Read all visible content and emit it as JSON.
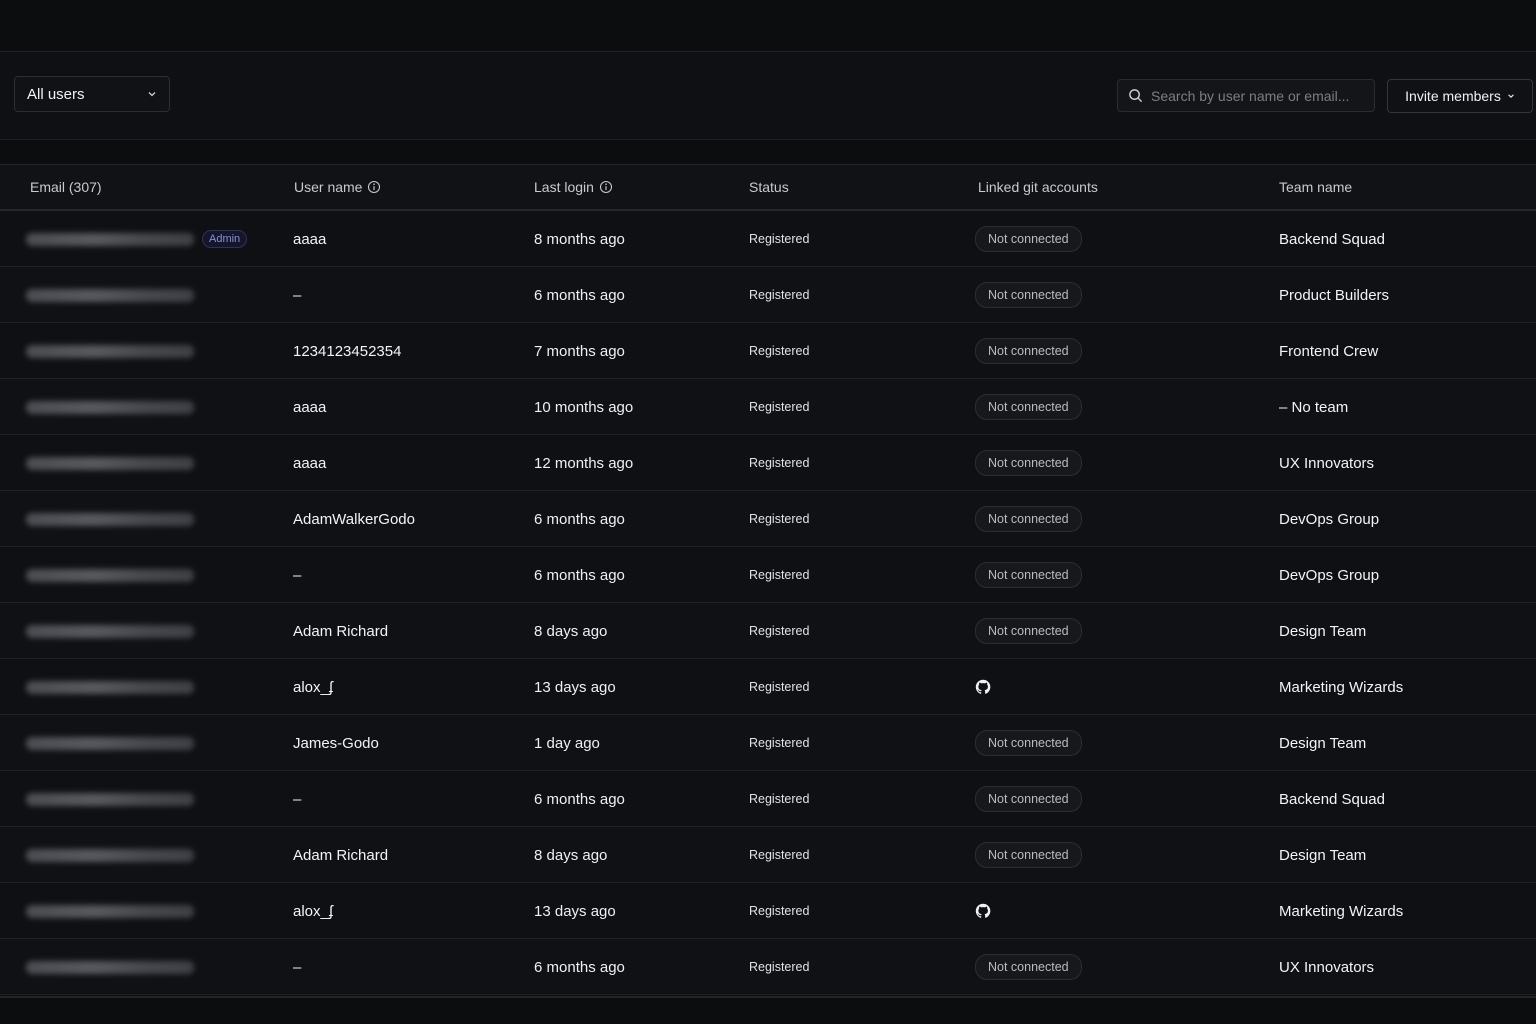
{
  "toolbar": {
    "filter_label": "All users",
    "search_placeholder": "Search by user name or email...",
    "invite_label": "Invite members"
  },
  "table": {
    "headers": {
      "email": "Email (307)",
      "user_name": "User name",
      "last_login": "Last login",
      "status": "Status",
      "linked_git": "Linked git accounts",
      "team_name": "Team name"
    },
    "rows": [
      {
        "admin": "Admin",
        "user": "aaaa",
        "login": "8 months ago",
        "status": "Registered",
        "git": "Not connected",
        "team": "Backend Squad"
      },
      {
        "user": "–",
        "login": "6 months ago",
        "status": "Registered",
        "git": "Not connected",
        "team": "Product Builders"
      },
      {
        "user": "1234123452354",
        "login": "7 months ago",
        "status": "Registered",
        "git": "Not connected",
        "team": "Frontend Crew"
      },
      {
        "user": "aaaa",
        "login": "10 months ago",
        "status": "Registered",
        "git": "Not connected",
        "team": "– No team"
      },
      {
        "user": "aaaa",
        "login": "12 months ago",
        "status": "Registered",
        "git": "Not connected",
        "team": "UX Innovators"
      },
      {
        "user": "AdamWalkerGodo",
        "login": "6 months ago",
        "status": "Registered",
        "git": "Not connected",
        "team": "DevOps Group"
      },
      {
        "user": "–",
        "login": "6 months ago",
        "status": "Registered",
        "git": "Not connected",
        "team": "DevOps Group"
      },
      {
        "user": "Adam Richard",
        "login": "8 days ago",
        "status": "Registered",
        "git": "Not connected",
        "team": "Design Team"
      },
      {
        "user": "alox_ʄ",
        "login": "13 days ago",
        "status": "Registered",
        "git_icon": "github-icon",
        "team": "Marketing Wizards"
      },
      {
        "user": "James-Godo",
        "login": "1 day ago",
        "status": "Registered",
        "git": "Not connected",
        "team": "Design Team"
      },
      {
        "user": "–",
        "login": "6 months ago",
        "status": "Registered",
        "git": "Not connected",
        "team": "Backend Squad"
      },
      {
        "user": "Adam Richard",
        "login": "8 days ago",
        "status": "Registered",
        "git": "Not connected",
        "team": "Design Team"
      },
      {
        "user": "alox_ʄ",
        "login": "13 days ago",
        "status": "Registered",
        "git_icon": "github-icon",
        "team": "Marketing Wizards"
      },
      {
        "user": "–",
        "login": "6 months ago",
        "status": "Registered",
        "git": "Not connected",
        "team": "UX Innovators"
      }
    ]
  }
}
